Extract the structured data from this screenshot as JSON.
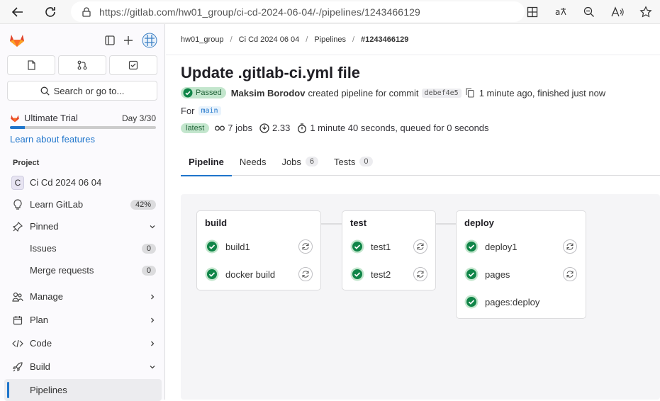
{
  "browser": {
    "url": "https://gitlab.com/hw01_group/ci-cd-2024-06-04/-/pipelines/1243466129",
    "icons": [
      "back-icon",
      "refresh-icon",
      "lock-icon",
      "apps-icon",
      "translate-icon",
      "zoom-icon",
      "read-aloud-icon",
      "favorite-icon"
    ]
  },
  "sidebar": {
    "search_label": "Search or go to...",
    "trial": {
      "name": "Ultimate Trial",
      "day": "Day 3/30",
      "progress": 0.1
    },
    "learn_link": "Learn about features",
    "section_title": "Project",
    "project": {
      "avatar_letter": "C",
      "name": "Ci Cd 2024 06 04"
    },
    "learn_gitlab": {
      "label": "Learn GitLab",
      "percent": "42%"
    },
    "pinned": "Pinned",
    "issues": {
      "label": "Issues",
      "count": "0"
    },
    "merge_requests": {
      "label": "Merge requests",
      "count": "0"
    },
    "manage": "Manage",
    "plan": "Plan",
    "code": "Code",
    "build": "Build",
    "pipelines": "Pipelines"
  },
  "breadcrumb": {
    "group": "hw01_group",
    "project": "Ci Cd 2024 06 04",
    "pipelines": "Pipelines",
    "current": "#1243466129"
  },
  "pipeline": {
    "title": "Update .gitlab-ci.yml file",
    "status": "Passed",
    "author": "Maksim Borodov",
    "created_text": "created pipeline for commit",
    "commit": "debef4e5",
    "time_text": "1 minute ago, finished just now",
    "for_label": "For",
    "branch": "main",
    "latest": "latest",
    "jobs": "7 jobs",
    "compute": "2.33",
    "duration": "1 minute 40 seconds, queued for 0 seconds"
  },
  "tabs": [
    {
      "label": "Pipeline",
      "count": ""
    },
    {
      "label": "Needs",
      "count": ""
    },
    {
      "label": "Jobs",
      "count": "6"
    },
    {
      "label": "Tests",
      "count": "0"
    }
  ],
  "stages": [
    {
      "name": "build",
      "jobs": [
        "build1",
        "docker build"
      ]
    },
    {
      "name": "test",
      "jobs": [
        "test1",
        "test2"
      ]
    },
    {
      "name": "deploy",
      "jobs": [
        "deploy1",
        "pages",
        "pages:deploy"
      ]
    }
  ],
  "colors": {
    "accent": "#1f75cb",
    "success": "#108548",
    "tanuki": "#e24329"
  }
}
